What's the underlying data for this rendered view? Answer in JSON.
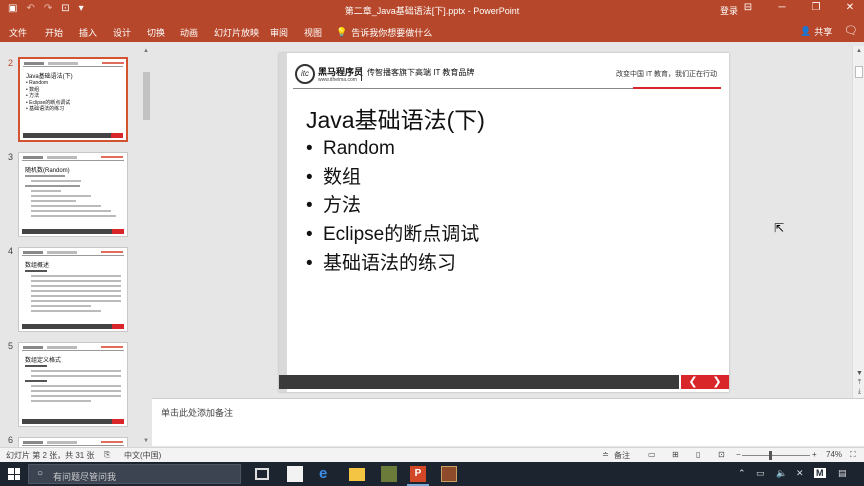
{
  "titlebar": {
    "document_title": "第二章_Java基础语法[下].pptx - PowerPoint",
    "login_label": "登录",
    "qat_icons": [
      "save-icon",
      "undo-icon",
      "redo-icon",
      "start-slideshow-icon",
      "customize-icon"
    ]
  },
  "ribbon": {
    "tabs": [
      "文件",
      "开始",
      "插入",
      "设计",
      "切换",
      "动画",
      "幻灯片放映",
      "审阅",
      "视图"
    ],
    "tell_me": "告诉我你想要做什么",
    "share_label": "共享"
  },
  "thumbnails": [
    {
      "number": "2",
      "active": true,
      "title": "Java基础语法(下)",
      "items": [
        "Random",
        "数组",
        "方法",
        "Eclipse的断点调试",
        "基础语法的练习"
      ]
    },
    {
      "number": "3",
      "active": false,
      "title": "随机数(Random)"
    },
    {
      "number": "4",
      "active": false,
      "title": "数组概述"
    },
    {
      "number": "5",
      "active": false,
      "title": "数组定义格式"
    },
    {
      "number": "6",
      "active": false,
      "title": ""
    }
  ],
  "slide": {
    "brand_name": "黑马程序员",
    "brand_url": "www.itheima.com",
    "brand_tag": "传智播客旗下高端 IT 教育品牌",
    "slogan": "改变中国 IT 教育，我们正在行动",
    "title": "Java基础语法(下)",
    "bullets": [
      "Random",
      "数组",
      "方法",
      "Eclipse的断点调试",
      "基础语法的练习"
    ]
  },
  "notes": {
    "placeholder": "单击此处添加备注"
  },
  "statusbar": {
    "slide_info": "幻灯片 第 2 张，共 31 张",
    "language": "中文(中国)",
    "notes_label": "备注",
    "zoom": "74%"
  },
  "taskbar": {
    "search_placeholder": "有问题尽管问我",
    "apps": [
      "task-view-icon",
      "store-icon",
      "edge-icon",
      "file-explorer-icon",
      "app-icon",
      "powerpoint-icon",
      "game-icon"
    ],
    "ime": "M"
  },
  "colors": {
    "ribbon": "#b7472a",
    "slide_accent": "#d8262a",
    "taskbar": "#1c2430"
  }
}
